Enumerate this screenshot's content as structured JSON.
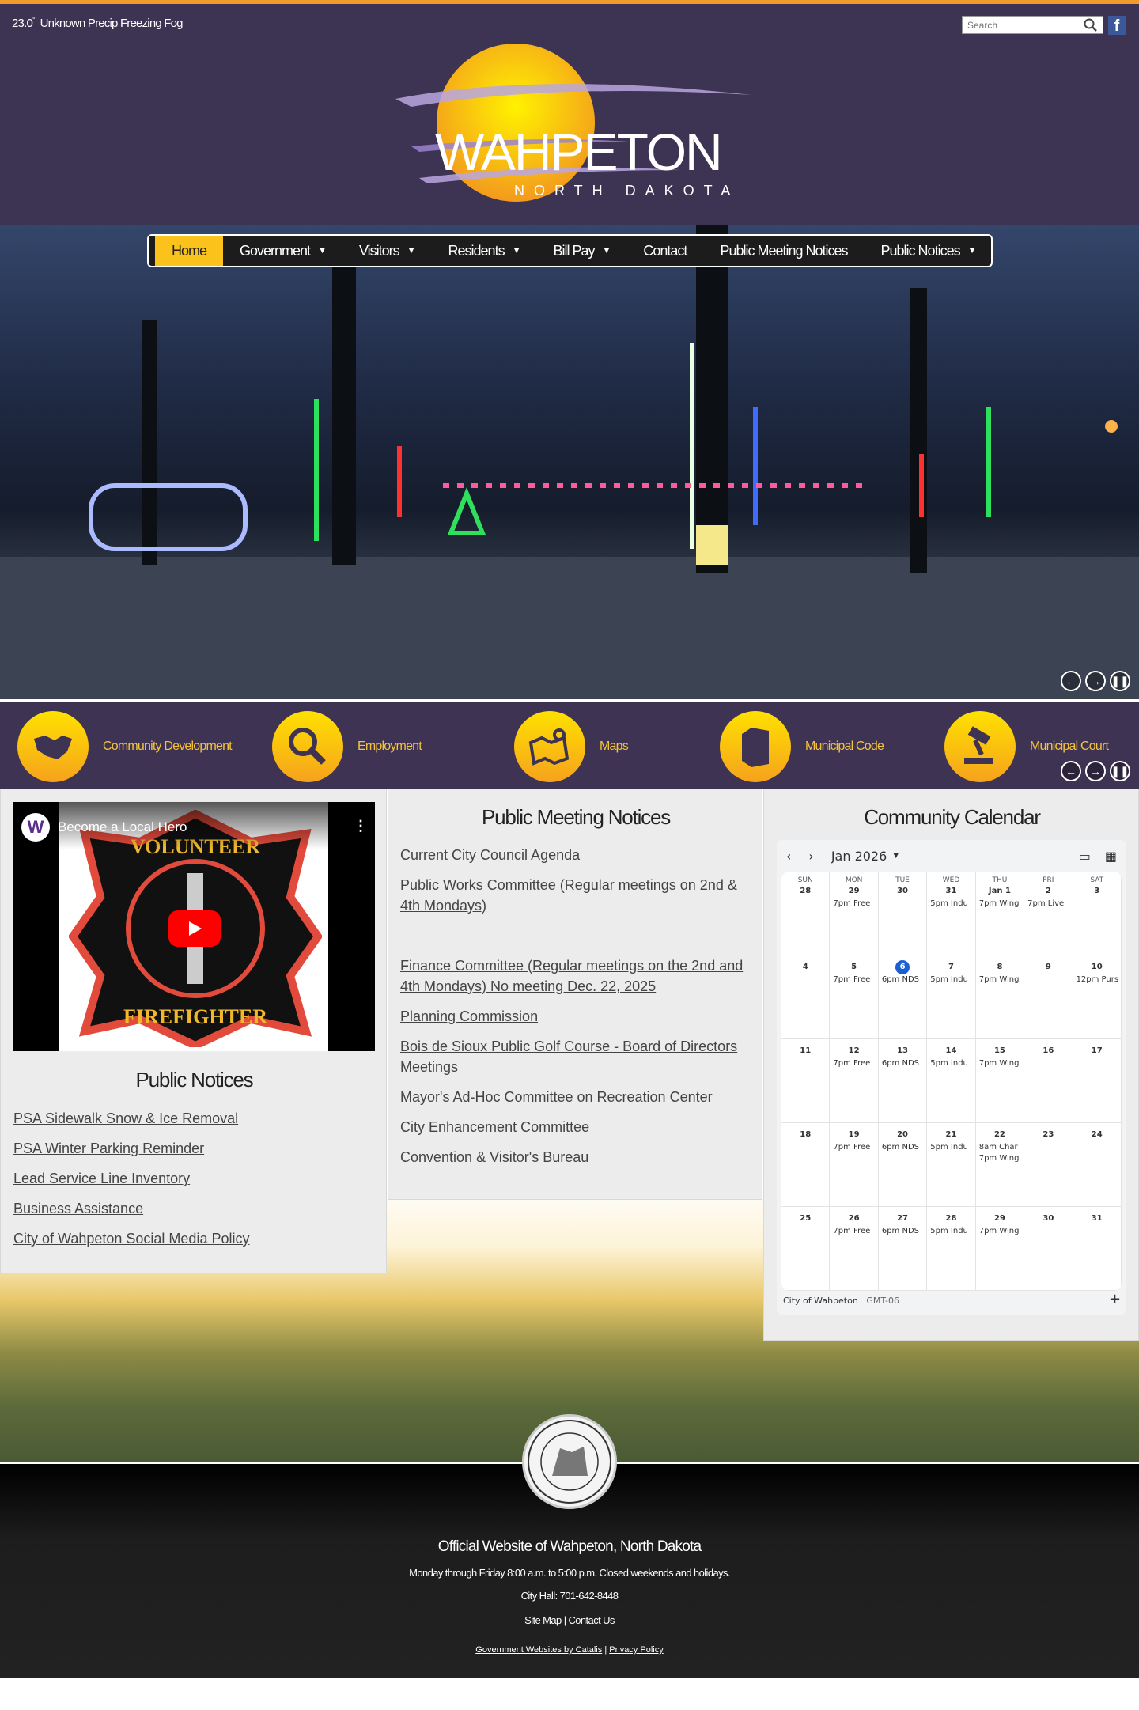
{
  "weather": {
    "temp": "23.0",
    "unit": "°",
    "condition": "Unknown Precip Freezing Fog"
  },
  "search": {
    "placeholder": "Search"
  },
  "logo": {
    "name": "WAHPETON",
    "sub": "NORTH DAKOTA"
  },
  "nav": [
    {
      "label": "Home",
      "active": true,
      "dropdown": false
    },
    {
      "label": "Government",
      "dropdown": true
    },
    {
      "label": "Visitors",
      "dropdown": true
    },
    {
      "label": "Residents",
      "dropdown": true
    },
    {
      "label": "Bill Pay",
      "dropdown": true
    },
    {
      "label": "Contact",
      "dropdown": false
    },
    {
      "label": "Public Meeting Notices",
      "dropdown": false
    },
    {
      "label": "Public Notices",
      "dropdown": true
    }
  ],
  "quick_links": [
    {
      "label": "Community Development",
      "icon": "handshake-icon"
    },
    {
      "label": "Employment",
      "icon": "magnifier-icon"
    },
    {
      "label": "Maps",
      "icon": "map-icon"
    },
    {
      "label": "Municipal Code",
      "icon": "book-icon"
    },
    {
      "label": "Municipal Court",
      "icon": "gavel-icon"
    }
  ],
  "video": {
    "title": "Become a Local Hero",
    "top_text": "VOLUNTEER",
    "bottom_text": "FIREFIGHTER"
  },
  "public_notices": {
    "title": "Public Notices",
    "links": [
      "PSA Sidewalk Snow & Ice Removal",
      "PSA Winter Parking Reminder",
      "Lead Service Line Inventory",
      "Business Assistance",
      "City of Wahpeton Social Media Policy"
    ]
  },
  "meeting_notices": {
    "title": "Public Meeting Notices",
    "links": [
      "Current City Council Agenda",
      "Public Works Committee (Regular meetings on 2nd & 4th Mondays)",
      "Finance Committee (Regular meetings on the 2nd and 4th Mondays) No meeting Dec. 22, 2025",
      "Planning Commission",
      "Bois de Sioux Public Golf Course - Board of Directors Meetings",
      "Mayor's Ad-Hoc Committee on Recreation Center",
      "City Enhancement Committee",
      "Convention & Visitor's Bureau"
    ]
  },
  "calendar": {
    "title": "Community Calendar",
    "month": "Jan 2026",
    "dows": [
      "SUN",
      "MON",
      "TUE",
      "WED",
      "THU",
      "FRI",
      "SAT"
    ],
    "cells": [
      {
        "day": "28",
        "ev": []
      },
      {
        "day": "29",
        "ev": [
          "7pm Free"
        ]
      },
      {
        "day": "30",
        "ev": []
      },
      {
        "day": "31",
        "ev": [
          "5pm Indu"
        ]
      },
      {
        "day": "Jan 1",
        "ev": [
          "7pm Wing"
        ]
      },
      {
        "day": "2",
        "ev": [
          "7pm Live"
        ]
      },
      {
        "day": "3",
        "ev": []
      },
      {
        "day": "4",
        "ev": []
      },
      {
        "day": "5",
        "ev": [
          "7pm Free"
        ]
      },
      {
        "day": "6",
        "today": true,
        "ev": [
          "6pm NDS"
        ]
      },
      {
        "day": "7",
        "ev": [
          "5pm Indu"
        ]
      },
      {
        "day": "8",
        "ev": [
          "7pm Wing"
        ]
      },
      {
        "day": "9",
        "ev": []
      },
      {
        "day": "10",
        "ev": [
          "12pm Purs"
        ]
      },
      {
        "day": "11",
        "ev": []
      },
      {
        "day": "12",
        "ev": [
          "7pm Free"
        ]
      },
      {
        "day": "13",
        "ev": [
          "6pm NDS"
        ]
      },
      {
        "day": "14",
        "ev": [
          "5pm Indu"
        ]
      },
      {
        "day": "15",
        "ev": [
          "7pm Wing"
        ]
      },
      {
        "day": "16",
        "ev": []
      },
      {
        "day": "17",
        "ev": []
      },
      {
        "day": "18",
        "ev": []
      },
      {
        "day": "19",
        "ev": [
          "7pm Free"
        ]
      },
      {
        "day": "20",
        "ev": [
          "6pm NDS"
        ]
      },
      {
        "day": "21",
        "ev": [
          "5pm Indu"
        ]
      },
      {
        "day": "22",
        "ev": [
          "8am Char",
          "7pm Wing"
        ]
      },
      {
        "day": "23",
        "ev": []
      },
      {
        "day": "24",
        "ev": []
      },
      {
        "day": "25",
        "ev": []
      },
      {
        "day": "26",
        "ev": [
          "7pm Free"
        ]
      },
      {
        "day": "27",
        "ev": [
          "6pm NDS"
        ]
      },
      {
        "day": "28",
        "ev": [
          "5pm Indu"
        ]
      },
      {
        "day": "29",
        "ev": [
          "7pm Wing"
        ]
      },
      {
        "day": "30",
        "ev": []
      },
      {
        "day": "31",
        "ev": []
      }
    ],
    "calendar_name": "City of Wahpeton",
    "timezone": "GMT-06",
    "today_color": "#1a5fd4"
  },
  "footer": {
    "title": "Official Website of Wahpeton, North Dakota",
    "hours": "Monday through Friday 8:00 a.m. to 5:00 p.m. Closed weekends and holidays.",
    "phone": "City Hall: 701-642-8448",
    "site_map": "Site Map",
    "contact_us": "Contact Us",
    "vendor": "Government Websites by Catalis",
    "privacy": "Privacy Policy"
  },
  "colors": {
    "header": "#3d3352",
    "accent": "#fbc21b",
    "top_line": "#f39a2c"
  }
}
